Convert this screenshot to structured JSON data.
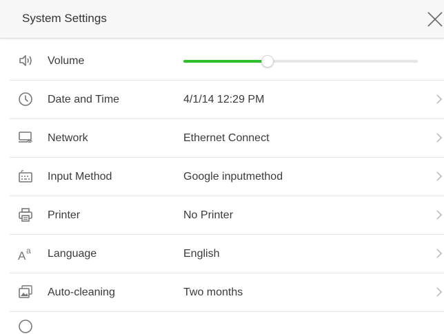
{
  "header": {
    "title": "System Settings",
    "close_icon": "close-icon"
  },
  "volume": {
    "label": "Volume",
    "icon": "speaker-icon",
    "level": 0.36,
    "accent": "#2fbf2a"
  },
  "rows": [
    {
      "label": "Date and Time",
      "value": "4/1/14 12:29 PM",
      "icon": "clock-icon"
    },
    {
      "label": "Network",
      "value": "Ethernet Connect",
      "icon": "network-icon"
    },
    {
      "label": "Input Method",
      "value": "Google inputmethod",
      "icon": "keyboard-icon"
    },
    {
      "label": "Printer",
      "value": "No Printer",
      "icon": "printer-icon"
    },
    {
      "label": "Language",
      "value": "English",
      "icon": "language-icon"
    },
    {
      "label": "Auto-cleaning",
      "value": "Two months",
      "icon": "images-icon"
    }
  ]
}
